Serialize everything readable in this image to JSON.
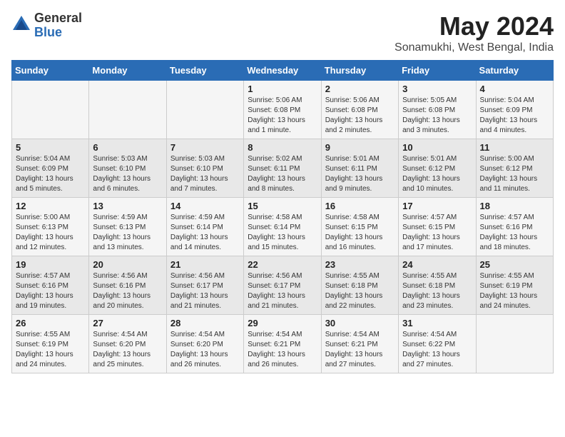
{
  "header": {
    "logo_general": "General",
    "logo_blue": "Blue",
    "month_title": "May 2024",
    "location": "Sonamukhi, West Bengal, India"
  },
  "days_of_week": [
    "Sunday",
    "Monday",
    "Tuesday",
    "Wednesday",
    "Thursday",
    "Friday",
    "Saturday"
  ],
  "weeks": [
    [
      {
        "day": "",
        "info": ""
      },
      {
        "day": "",
        "info": ""
      },
      {
        "day": "",
        "info": ""
      },
      {
        "day": "1",
        "info": "Sunrise: 5:06 AM\nSunset: 6:08 PM\nDaylight: 13 hours\nand 1 minute."
      },
      {
        "day": "2",
        "info": "Sunrise: 5:06 AM\nSunset: 6:08 PM\nDaylight: 13 hours\nand 2 minutes."
      },
      {
        "day": "3",
        "info": "Sunrise: 5:05 AM\nSunset: 6:08 PM\nDaylight: 13 hours\nand 3 minutes."
      },
      {
        "day": "4",
        "info": "Sunrise: 5:04 AM\nSunset: 6:09 PM\nDaylight: 13 hours\nand 4 minutes."
      }
    ],
    [
      {
        "day": "5",
        "info": "Sunrise: 5:04 AM\nSunset: 6:09 PM\nDaylight: 13 hours\nand 5 minutes."
      },
      {
        "day": "6",
        "info": "Sunrise: 5:03 AM\nSunset: 6:10 PM\nDaylight: 13 hours\nand 6 minutes."
      },
      {
        "day": "7",
        "info": "Sunrise: 5:03 AM\nSunset: 6:10 PM\nDaylight: 13 hours\nand 7 minutes."
      },
      {
        "day": "8",
        "info": "Sunrise: 5:02 AM\nSunset: 6:11 PM\nDaylight: 13 hours\nand 8 minutes."
      },
      {
        "day": "9",
        "info": "Sunrise: 5:01 AM\nSunset: 6:11 PM\nDaylight: 13 hours\nand 9 minutes."
      },
      {
        "day": "10",
        "info": "Sunrise: 5:01 AM\nSunset: 6:12 PM\nDaylight: 13 hours\nand 10 minutes."
      },
      {
        "day": "11",
        "info": "Sunrise: 5:00 AM\nSunset: 6:12 PM\nDaylight: 13 hours\nand 11 minutes."
      }
    ],
    [
      {
        "day": "12",
        "info": "Sunrise: 5:00 AM\nSunset: 6:13 PM\nDaylight: 13 hours\nand 12 minutes."
      },
      {
        "day": "13",
        "info": "Sunrise: 4:59 AM\nSunset: 6:13 PM\nDaylight: 13 hours\nand 13 minutes."
      },
      {
        "day": "14",
        "info": "Sunrise: 4:59 AM\nSunset: 6:14 PM\nDaylight: 13 hours\nand 14 minutes."
      },
      {
        "day": "15",
        "info": "Sunrise: 4:58 AM\nSunset: 6:14 PM\nDaylight: 13 hours\nand 15 minutes."
      },
      {
        "day": "16",
        "info": "Sunrise: 4:58 AM\nSunset: 6:15 PM\nDaylight: 13 hours\nand 16 minutes."
      },
      {
        "day": "17",
        "info": "Sunrise: 4:57 AM\nSunset: 6:15 PM\nDaylight: 13 hours\nand 17 minutes."
      },
      {
        "day": "18",
        "info": "Sunrise: 4:57 AM\nSunset: 6:16 PM\nDaylight: 13 hours\nand 18 minutes."
      }
    ],
    [
      {
        "day": "19",
        "info": "Sunrise: 4:57 AM\nSunset: 6:16 PM\nDaylight: 13 hours\nand 19 minutes."
      },
      {
        "day": "20",
        "info": "Sunrise: 4:56 AM\nSunset: 6:16 PM\nDaylight: 13 hours\nand 20 minutes."
      },
      {
        "day": "21",
        "info": "Sunrise: 4:56 AM\nSunset: 6:17 PM\nDaylight: 13 hours\nand 21 minutes."
      },
      {
        "day": "22",
        "info": "Sunrise: 4:56 AM\nSunset: 6:17 PM\nDaylight: 13 hours\nand 21 minutes."
      },
      {
        "day": "23",
        "info": "Sunrise: 4:55 AM\nSunset: 6:18 PM\nDaylight: 13 hours\nand 22 minutes."
      },
      {
        "day": "24",
        "info": "Sunrise: 4:55 AM\nSunset: 6:18 PM\nDaylight: 13 hours\nand 23 minutes."
      },
      {
        "day": "25",
        "info": "Sunrise: 4:55 AM\nSunset: 6:19 PM\nDaylight: 13 hours\nand 24 minutes."
      }
    ],
    [
      {
        "day": "26",
        "info": "Sunrise: 4:55 AM\nSunset: 6:19 PM\nDaylight: 13 hours\nand 24 minutes."
      },
      {
        "day": "27",
        "info": "Sunrise: 4:54 AM\nSunset: 6:20 PM\nDaylight: 13 hours\nand 25 minutes."
      },
      {
        "day": "28",
        "info": "Sunrise: 4:54 AM\nSunset: 6:20 PM\nDaylight: 13 hours\nand 26 minutes."
      },
      {
        "day": "29",
        "info": "Sunrise: 4:54 AM\nSunset: 6:21 PM\nDaylight: 13 hours\nand 26 minutes."
      },
      {
        "day": "30",
        "info": "Sunrise: 4:54 AM\nSunset: 6:21 PM\nDaylight: 13 hours\nand 27 minutes."
      },
      {
        "day": "31",
        "info": "Sunrise: 4:54 AM\nSunset: 6:22 PM\nDaylight: 13 hours\nand 27 minutes."
      },
      {
        "day": "",
        "info": ""
      }
    ]
  ]
}
